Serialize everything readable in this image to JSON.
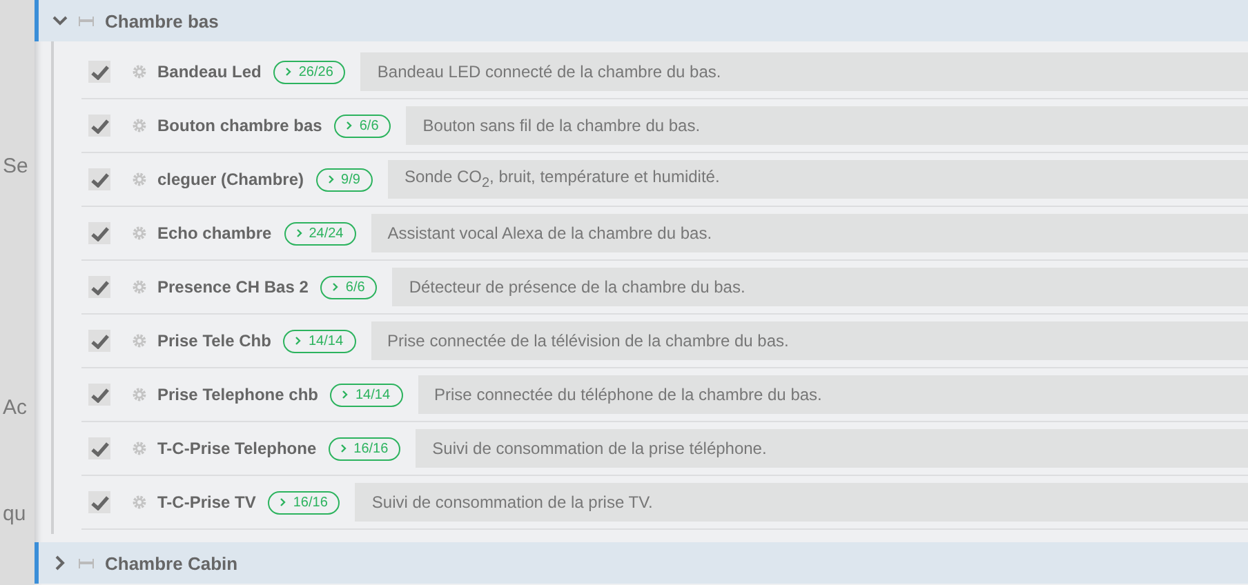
{
  "background_labels": [
    "Se",
    "Ac",
    "qu"
  ],
  "groups": [
    {
      "title": "Chambre bas",
      "expanded": true,
      "items": [
        {
          "name": "Bandeau Led",
          "checked": true,
          "count": "26/26",
          "description": "Bandeau LED connecté de la chambre du bas."
        },
        {
          "name": "Bouton chambre bas",
          "checked": true,
          "count": "6/6",
          "description": "Bouton sans fil de la chambre du bas."
        },
        {
          "name": "cleguer (Chambre)",
          "checked": true,
          "count": "9/9",
          "description": "Sonde CO$_{2}$, bruit, température et humidité."
        },
        {
          "name": "Echo chambre",
          "checked": true,
          "count": "24/24",
          "description": "Assistant vocal Alexa de la chambre du bas."
        },
        {
          "name": "Presence CH Bas 2",
          "checked": true,
          "count": "6/6",
          "description": "Détecteur de présence de la chambre du bas."
        },
        {
          "name": "Prise Tele Chb",
          "checked": true,
          "count": "14/14",
          "description": "Prise connectée de la télévision de la chambre du bas."
        },
        {
          "name": "Prise Telephone chb",
          "checked": true,
          "count": "14/14",
          "description": "Prise connectée du téléphone de la chambre du bas."
        },
        {
          "name": "T-C-Prise Telephone",
          "checked": true,
          "count": "16/16",
          "description": "Suivi de consommation de la prise téléphone."
        },
        {
          "name": "T-C-Prise TV",
          "checked": true,
          "count": "16/16",
          "description": "Suivi de consommation de la prise TV."
        }
      ]
    },
    {
      "title": "Chambre Cabin",
      "expanded": false
    }
  ]
}
